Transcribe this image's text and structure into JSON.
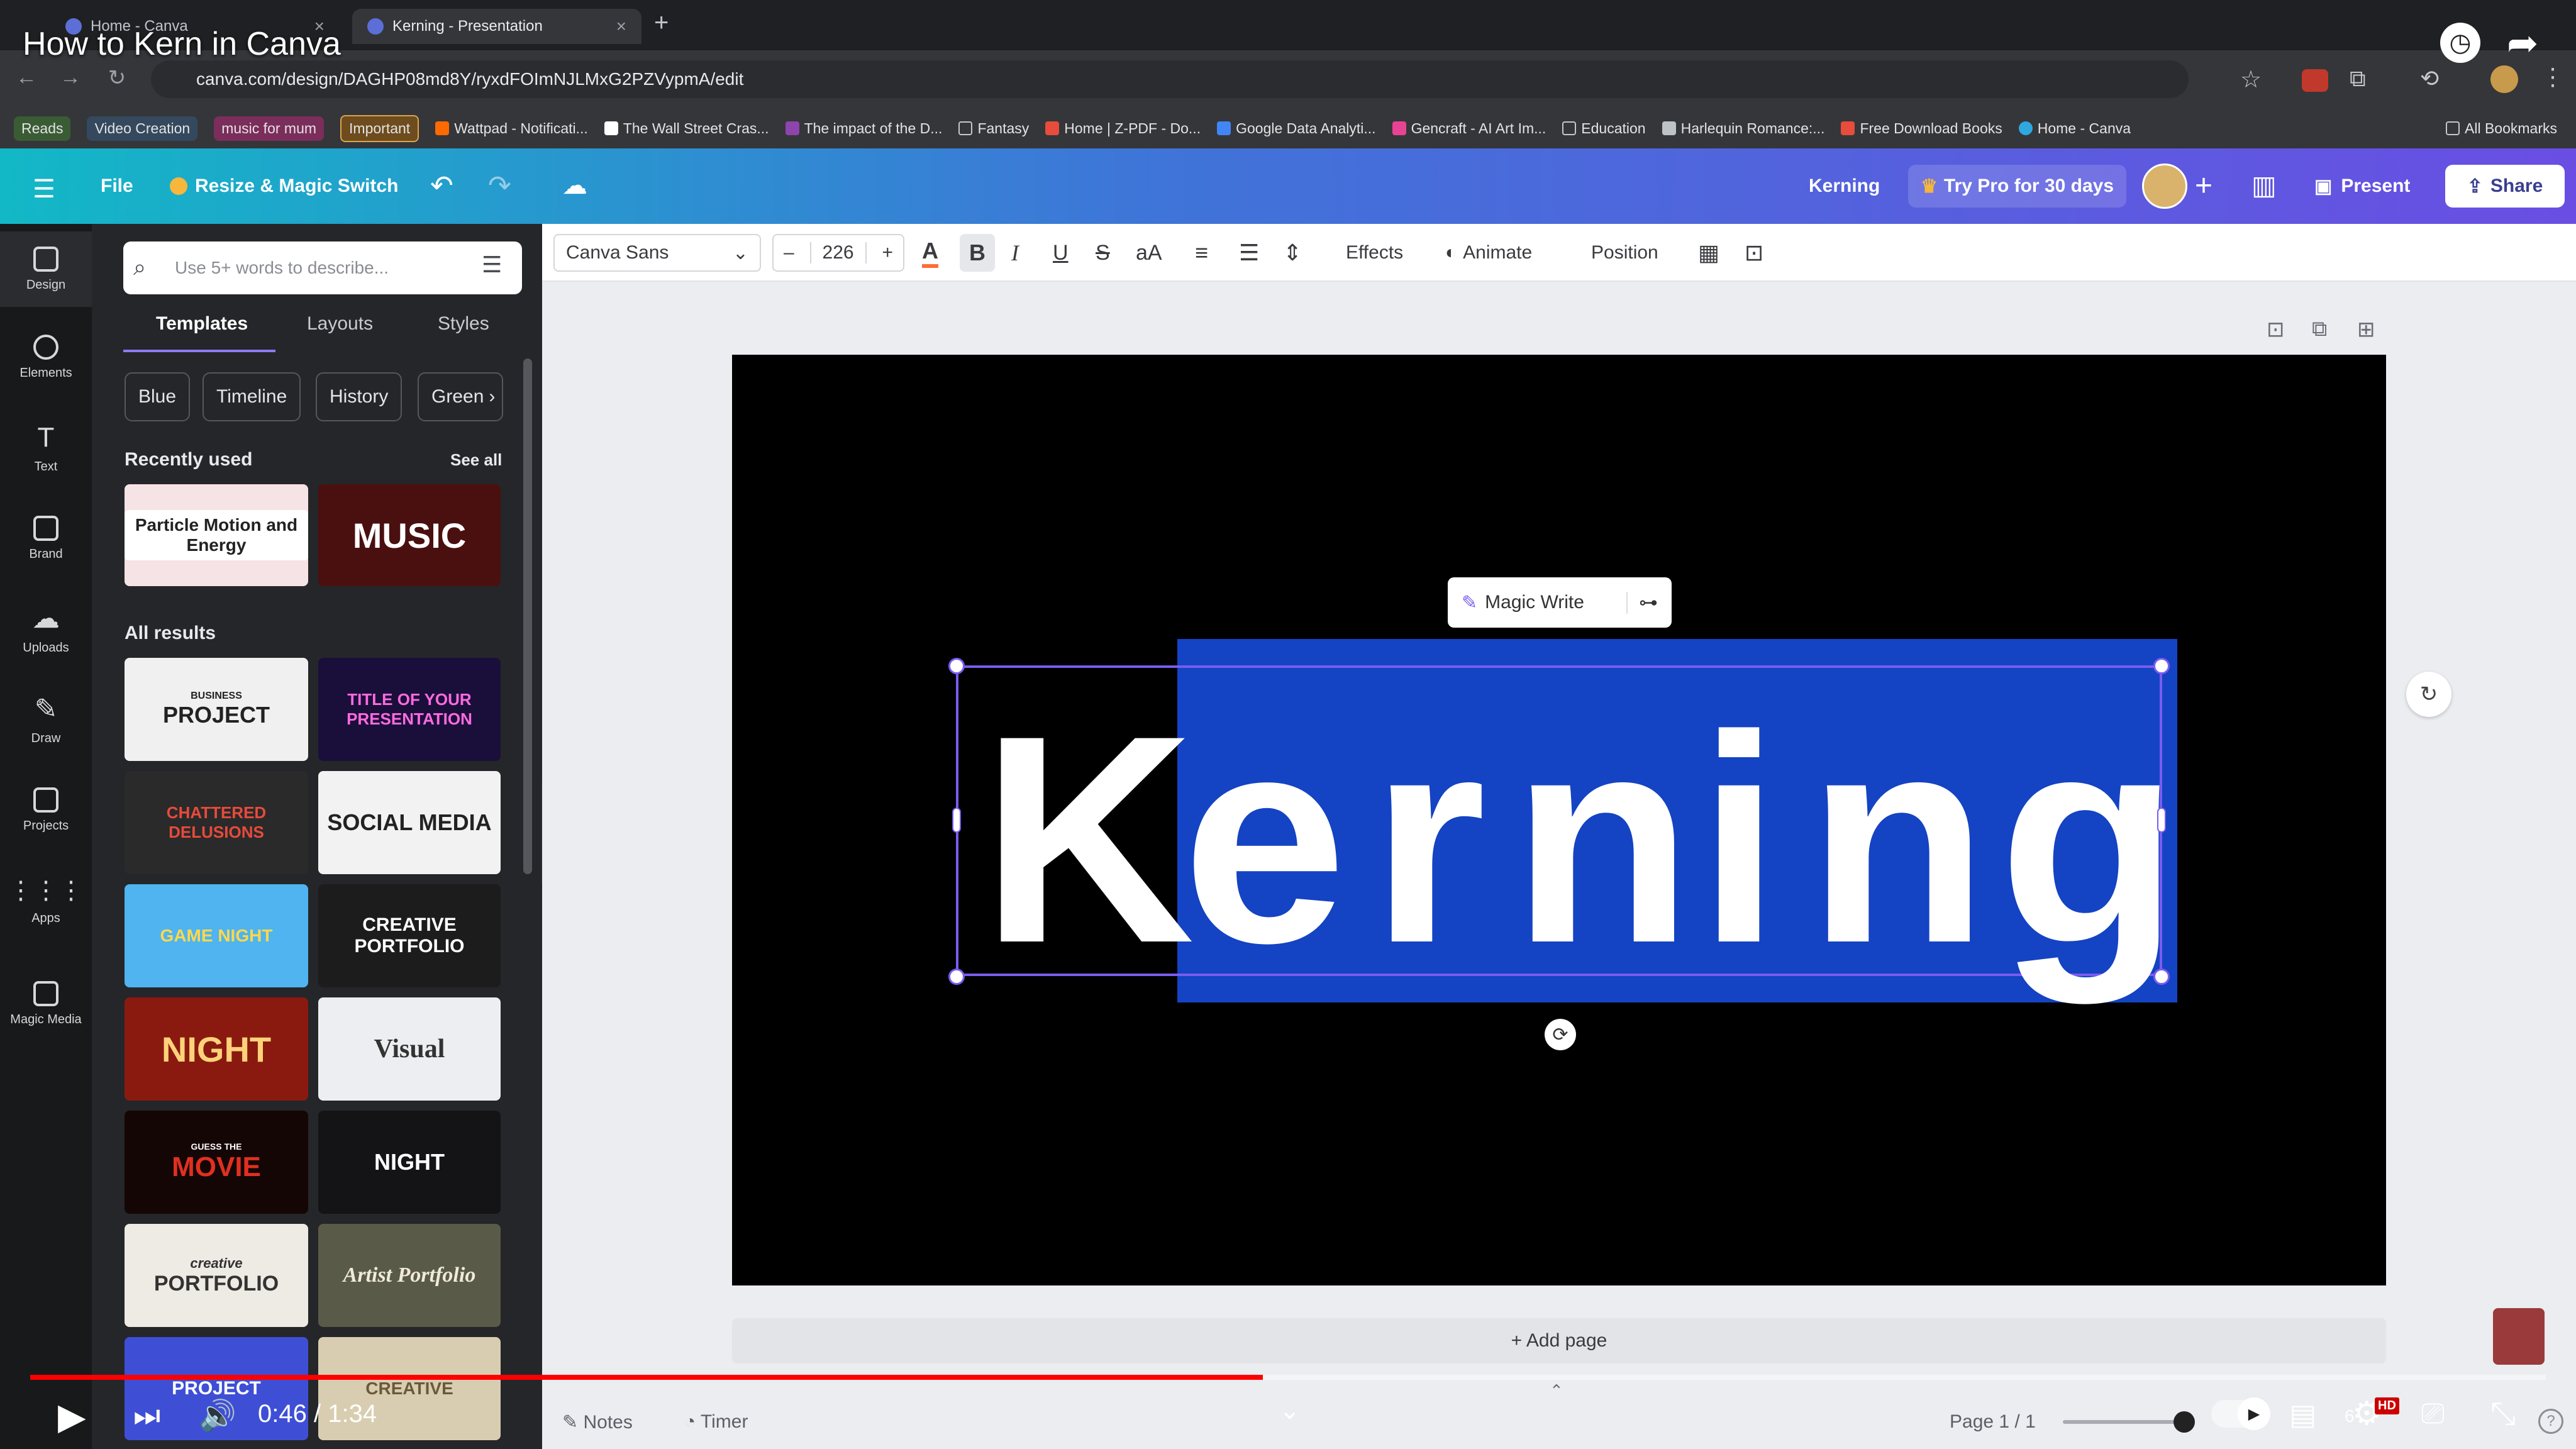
{
  "video": {
    "title": "How to Kern in Canva",
    "time_current": "0:46",
    "time_total": "1:34",
    "time_separator": "/",
    "progress": 0.49,
    "quality_badge": "HD",
    "speed_partial": "6"
  },
  "browser": {
    "tabs": [
      {
        "label": "Home - Canva"
      },
      {
        "label": "Kerning - Presentation"
      }
    ],
    "new_tab": "+",
    "url": "canva.com/design/DAGHP08md8Y/ryxdFOImNJLMxG2PZVypmA/edit",
    "bookmarks": [
      "Reads",
      "Video Creation",
      "music for mum",
      "Important",
      "Wattpad - Notificati...",
      "The Wall Street Cras...",
      "The impact of the D...",
      "Fantasy",
      "Home | Z-PDF - Do...",
      "Google Data Analyti...",
      "Gencraft - AI Art Im...",
      "Education",
      "Harlequin Romance:...",
      "Free Download Books",
      "Home - Canva"
    ],
    "all_bookmarks": "All Bookmarks"
  },
  "canva_header": {
    "file": "File",
    "resize": "Resize & Magic Switch",
    "doc_title": "Kerning",
    "try_pro": "Try Pro for 30 days",
    "present": "Present",
    "share": "Share"
  },
  "rail": [
    {
      "label": "Design",
      "icon": "design-icon"
    },
    {
      "label": "Elements",
      "icon": "elements-icon"
    },
    {
      "label": "Text",
      "icon": "text-icon"
    },
    {
      "label": "Brand",
      "icon": "brand-icon"
    },
    {
      "label": "Uploads",
      "icon": "uploads-icon"
    },
    {
      "label": "Draw",
      "icon": "draw-icon"
    },
    {
      "label": "Projects",
      "icon": "projects-icon"
    },
    {
      "label": "Apps",
      "icon": "apps-icon"
    },
    {
      "label": "Magic Media",
      "icon": "magic-media-icon"
    }
  ],
  "panel": {
    "search_placeholder": "Use 5+ words to describe...",
    "tabs": [
      "Templates",
      "Layouts",
      "Styles"
    ],
    "chips": [
      "Blue",
      "Timeline",
      "History",
      "Green"
    ],
    "recently_used": "Recently used",
    "see_all": "See all",
    "all_results": "All results",
    "recent": [
      {
        "text": "Particle Motion and Energy"
      },
      {
        "text": "MUSIC"
      }
    ],
    "results": [
      {
        "text": "PROJECT",
        "sub": "BUSINESS"
      },
      {
        "text": "TITLE OF YOUR PRESENTATION"
      },
      {
        "text": "CHATTERED DELUSIONS"
      },
      {
        "text": "SOCIAL MEDIA"
      },
      {
        "text": "GAME NIGHT"
      },
      {
        "text": "CREATIVE PORTFOLIO"
      },
      {
        "text": "NIGHT"
      },
      {
        "text": "Visual"
      },
      {
        "text": "MOVIE",
        "sub": "GUESS THE"
      },
      {
        "text": "NIGHT"
      },
      {
        "text": "PORTFOLIO",
        "sub": "creative"
      },
      {
        "text": "Artist Portfolio"
      },
      {
        "text": "PROJECT"
      },
      {
        "text": "CREATIVE"
      }
    ]
  },
  "toolbar": {
    "font": "Canva Sans",
    "size": "226",
    "minus": "–",
    "plus": "+",
    "effects": "Effects",
    "animate": "Animate",
    "position": "Position"
  },
  "canvas": {
    "text_first": "K",
    "text_rest": [
      "e",
      "r",
      "n",
      "i",
      "n",
      "g"
    ],
    "magic_write": "Magic Write",
    "add_page": "+ Add page"
  },
  "bottom": {
    "notes": "Notes",
    "timer": "Timer",
    "page": "Page 1 / 1"
  }
}
